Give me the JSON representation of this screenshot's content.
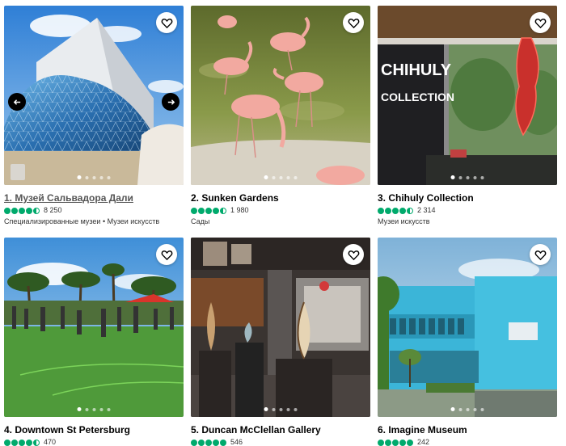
{
  "colors": {
    "rating_green": "#00aa6c"
  },
  "cards": [
    {
      "title": "1. Музей Сальвадора Дали",
      "rating_bubbles": 4.5,
      "reviews": "8 250",
      "category": "Специализированные музеи • Музеи искусств",
      "carousel_dots": 5,
      "active_dot": 1,
      "has_arrows": true,
      "save_icon": "heart-icon"
    },
    {
      "title": "2. Sunken Gardens",
      "rating_bubbles": 4.5,
      "reviews": "1 980",
      "category": "Сады",
      "carousel_dots": 5,
      "active_dot": 1,
      "save_icon": "heart-icon"
    },
    {
      "title": "3. Chihuly Collection",
      "rating_bubbles": 4.5,
      "reviews": "2 314",
      "category": "Музеи искусств",
      "carousel_dots": 5,
      "active_dot": 1,
      "save_icon": "heart-icon",
      "photo_sign": {
        "line1": "CHIHULY",
        "line2": "COLLECTION"
      }
    },
    {
      "title": "4. Downtown St Petersburg",
      "rating_bubbles": 4.5,
      "reviews": "470",
      "carousel_dots": 5,
      "active_dot": 1,
      "save_icon": "heart-icon"
    },
    {
      "title": "5. Duncan McClellan Gallery",
      "rating_bubbles": 5,
      "reviews": "546",
      "carousel_dots": 5,
      "active_dot": 1,
      "save_icon": "heart-icon"
    },
    {
      "title": "6. Imagine Museum",
      "rating_bubbles": 5,
      "reviews": "242",
      "carousel_dots": 5,
      "active_dot": 1,
      "save_icon": "heart-icon"
    }
  ]
}
